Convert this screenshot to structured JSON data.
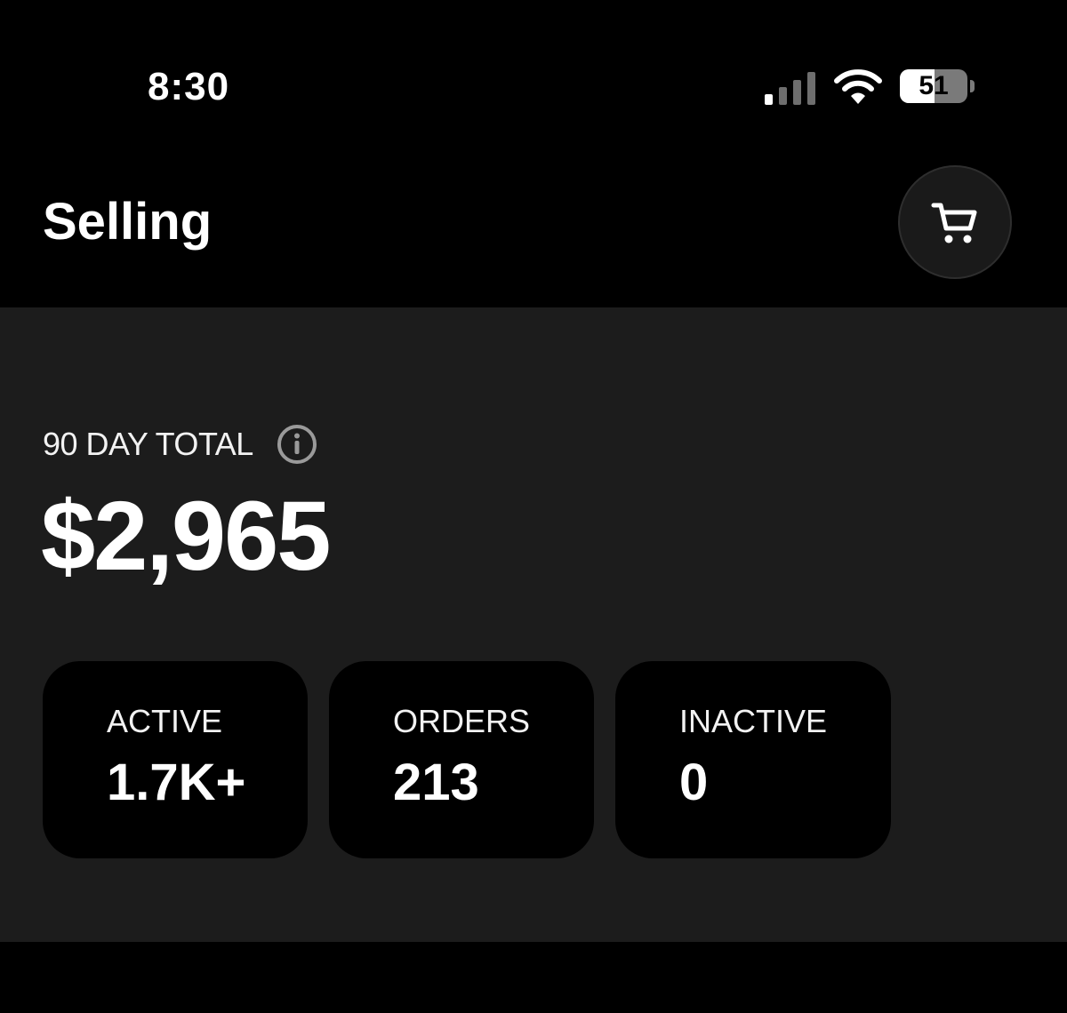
{
  "status_bar": {
    "time": "8:30",
    "battery_level": "51",
    "battery_fraction": 0.51,
    "signal_icon": "cellular-signal-icon",
    "wifi_icon": "wifi-icon"
  },
  "header": {
    "title": "Selling",
    "cart_icon": "shopping-cart-icon"
  },
  "summary": {
    "label": "90 DAY TOTAL",
    "info_icon": "info-icon",
    "total": "$2,965"
  },
  "stats": [
    {
      "label": "ACTIVE",
      "value": "1.7K+"
    },
    {
      "label": "ORDERS",
      "value": "213"
    },
    {
      "label": "INACTIVE",
      "value": "0"
    }
  ],
  "colors": {
    "background": "#000000",
    "panel": "#1c1c1c",
    "card": "#000000",
    "text": "#ffffff"
  }
}
